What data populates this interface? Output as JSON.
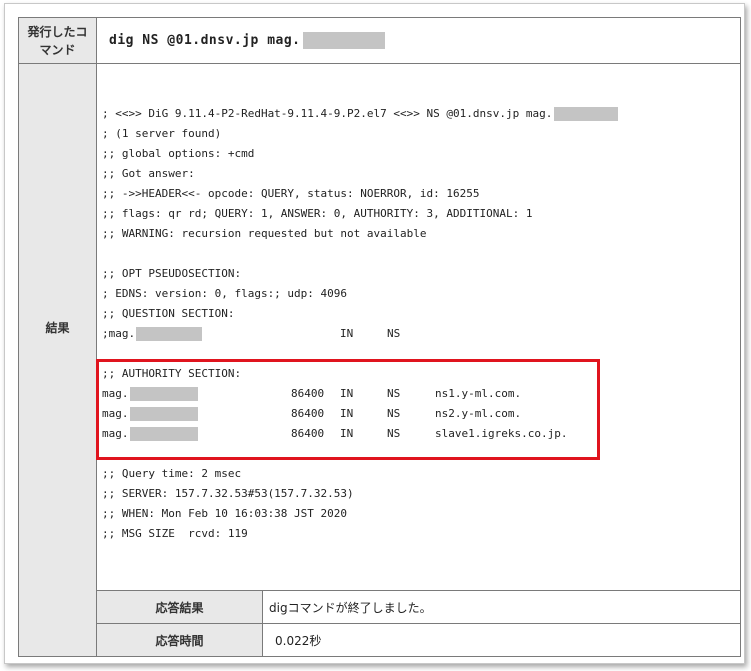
{
  "command_row": {
    "label": "発行したコマンド",
    "command": "dig NS @01.dnsv.jp mag."
  },
  "result_row": {
    "label": "結果",
    "lines": [
      "; <<>> DiG 9.11.4-P2-RedHat-9.11.4-9.P2.el7 <<>> NS @01.dnsv.jp mag.",
      "; (1 server found)",
      ";; global options: +cmd",
      ";; Got answer:",
      ";; ->>HEADER<<- opcode: QUERY, status: NOERROR, id: 16255",
      ";; flags: qr rd; QUERY: 1, ANSWER: 0, AUTHORITY: 3, ADDITIONAL: 1",
      ";; WARNING: recursion requested but not available",
      "",
      ";; OPT PSEUDOSECTION:",
      "; EDNS: version: 0, flags:; udp: 4096",
      ";; QUESTION SECTION:"
    ],
    "question": {
      "name": ";mag.",
      "class": "IN",
      "type": "NS"
    },
    "authority_header": ";; AUTHORITY SECTION:",
    "authority": [
      {
        "name": "mag.",
        "ttl": "86400",
        "class": "IN",
        "type": "NS",
        "value": "ns1.y-ml.com."
      },
      {
        "name": "mag.",
        "ttl": "86400",
        "class": "IN",
        "type": "NS",
        "value": "ns2.y-ml.com."
      },
      {
        "name": "mag.",
        "ttl": "86400",
        "class": "IN",
        "type": "NS",
        "value": "slave1.igreks.co.jp."
      }
    ],
    "footer_lines": [
      ";; Query time: 2 msec",
      ";; SERVER: 157.7.32.53#53(157.7.32.53)",
      ";; WHEN: Mon Feb 10 16:03:38 JST 2020",
      ";; MSG SIZE  rcvd: 119"
    ]
  },
  "response_result": {
    "label": "応答結果",
    "value": "digコマンドが終了しました。"
  },
  "response_time": {
    "label": "応答時間",
    "value": "0.022秒"
  },
  "colors": {
    "highlight": "#e0141e",
    "header_bg": "#e8e8e8",
    "mask": "#c4c4c4"
  }
}
